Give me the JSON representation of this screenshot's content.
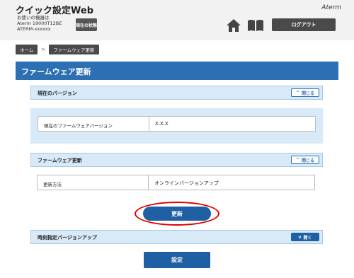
{
  "header": {
    "app_title": "クイック設定Web",
    "device_caption": "お使いの機器は",
    "device_model": "Aterm 19000T12BE",
    "device_id": "ATERM-xxxxxx",
    "status_button": "現在の状態",
    "brand": "Aterm",
    "logout_button": "ログアウト"
  },
  "breadcrumb": {
    "home": "ホーム",
    "separator": ">",
    "current": "ファームウェア更新"
  },
  "page_title": "ファームウェア更新",
  "sections": {
    "current_version": {
      "title": "現在のバージョン",
      "toggle": "閉じる",
      "row_key": "現在のファームウェアバージョン",
      "row_value": "X.X.X"
    },
    "firmware_update": {
      "title": "ファームウェア更新",
      "toggle": "閉じる",
      "row_key": "更新方法",
      "row_value": "オンラインバージョンアップ"
    },
    "scheduled_update": {
      "title": "時刻指定バージョンアップ",
      "toggle": "開く"
    }
  },
  "buttons": {
    "update": "更新",
    "apply": "設定"
  },
  "colors": {
    "accent": "#2c6fb3",
    "section_bg": "#d8e9f7",
    "highlight": "#e00000"
  }
}
